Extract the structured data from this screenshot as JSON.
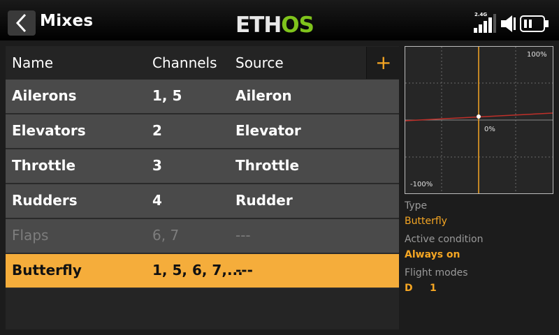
{
  "header": {
    "title": "Mixes",
    "logo_part1": "ETH",
    "logo_part2": "OS",
    "rf_label": "2.4G"
  },
  "table": {
    "columns": [
      "Name",
      "Channels",
      "Source"
    ],
    "add_label": "+",
    "rows": [
      {
        "name": "Ailerons",
        "channels": "1, 5",
        "source": "Aileron",
        "state": "normal"
      },
      {
        "name": "Elevators",
        "channels": "2",
        "source": "Elevator",
        "state": "normal"
      },
      {
        "name": "Throttle",
        "channels": "3",
        "source": "Throttle",
        "state": "normal"
      },
      {
        "name": "Rudders",
        "channels": "4",
        "source": "Rudder",
        "state": "normal"
      },
      {
        "name": "Flaps",
        "channels": "6, 7",
        "source": "---",
        "state": "disabled"
      },
      {
        "name": "Butterfly",
        "channels": "1, 5, 6, 7,...",
        "source": "---",
        "state": "selected"
      }
    ]
  },
  "graph": {
    "top_label": "100%",
    "mid_label": "0%",
    "bottom_label": "-100%"
  },
  "details": {
    "type_label": "Type",
    "type_value": "Butterfly",
    "condition_label": "Active condition",
    "condition_value": "Always on",
    "flight_modes_label": "Flight modes",
    "flight_modes_value": "D     1"
  },
  "colors": {
    "accent": "#f5a623",
    "selected_row": "#f5ad3b",
    "row_bg": "#4a4a4a",
    "logo_green": "#7fc31c",
    "curve_red": "#c0302a"
  }
}
